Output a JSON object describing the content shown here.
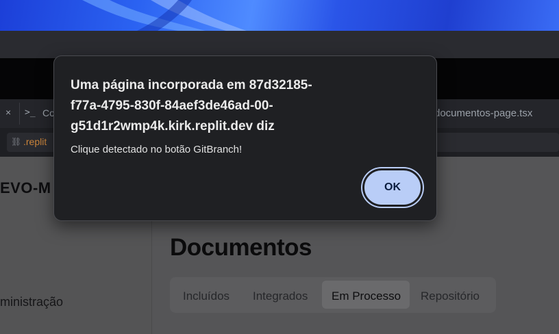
{
  "browser": {
    "tab_left_label": "Co",
    "tab_right_label": "documentos-page.tsx",
    "url_text": ".replit",
    "close_icon": "×",
    "terminal_icon": ">_",
    "link_icon": "⛓"
  },
  "app": {
    "brand": "EVO-M",
    "nav_admin": "ministração",
    "page_title": "Documentos",
    "tabs": [
      {
        "label": "Incluídos"
      },
      {
        "label": "Integrados"
      },
      {
        "label": "Em Processo"
      },
      {
        "label": "Repositório"
      }
    ],
    "active_tab": "Em Processo"
  },
  "dialog": {
    "title_lines": [
      "Uma página incorporada em 87d32185-",
      "f77a-4795-830f-84aef3de46ad-00-",
      "g51d1r2wmp4k.kirk.replit.dev diz"
    ],
    "message": "Clique detectado no botão GitBranch!",
    "ok_label": "OK"
  },
  "colors": {
    "accent": "#b9cdf7",
    "dialog_bg": "#1f2023",
    "wallpaper": "#2b63f2"
  }
}
